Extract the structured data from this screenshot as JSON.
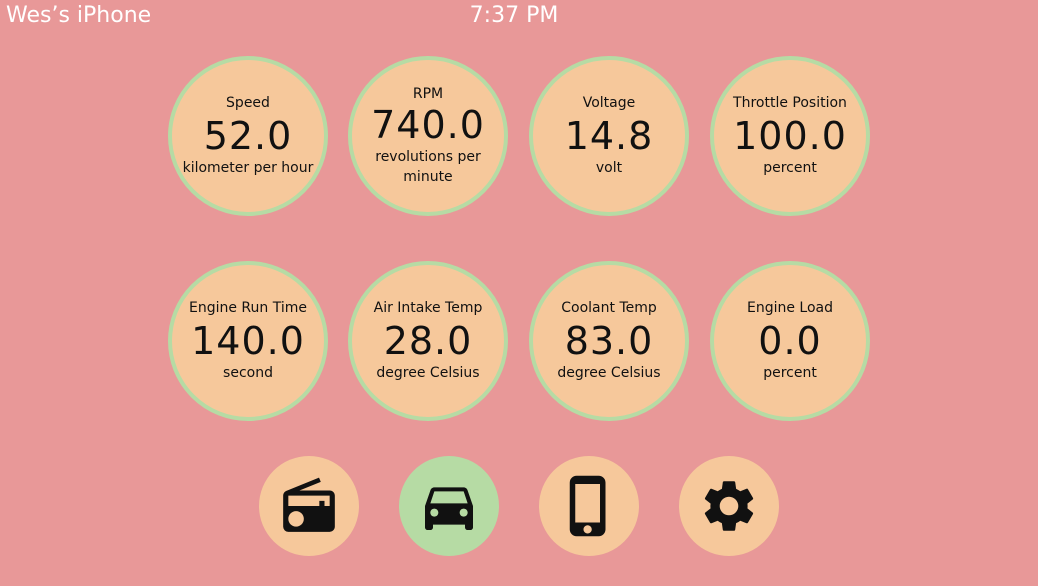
{
  "status_bar": {
    "device_name": "Wes’s iPhone",
    "time": "7:37 PM"
  },
  "gauges": [
    {
      "label": "Speed",
      "value": "52.0",
      "unit": "kilometer per hour"
    },
    {
      "label": "RPM",
      "value": "740.0",
      "unit": "revolutions per minute"
    },
    {
      "label": "Voltage",
      "value": "14.8",
      "unit": "volt"
    },
    {
      "label": "Throttle Position",
      "value": "100.0",
      "unit": "percent"
    },
    {
      "label": "Engine Run Time",
      "value": "140.0",
      "unit": "second"
    },
    {
      "label": "Air Intake Temp",
      "value": "28.0",
      "unit": "degree Celsius"
    },
    {
      "label": "Coolant Temp",
      "value": "83.0",
      "unit": "degree Celsius"
    },
    {
      "label": "Engine Load",
      "value": "0.0",
      "unit": "percent"
    }
  ],
  "nav": {
    "items": [
      {
        "icon": "radio-icon",
        "active": false
      },
      {
        "icon": "car-icon",
        "active": true
      },
      {
        "icon": "phone-icon",
        "active": false
      },
      {
        "icon": "gear-icon",
        "active": false
      }
    ]
  },
  "colors": {
    "background": "#e89898",
    "gauge_fill": "#f6c89b",
    "gauge_ring": "#b6dba4",
    "nav_inactive": "#f6c89b",
    "nav_active": "#b6dba4",
    "status_text": "#ffffff",
    "icon": "#111111"
  }
}
